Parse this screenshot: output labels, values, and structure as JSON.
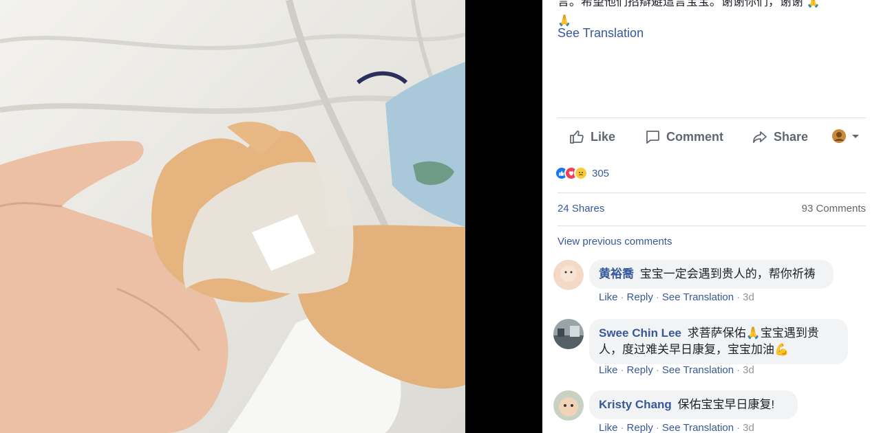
{
  "post": {
    "text_line": "言。希望他们招辯避這言宝宝。谢谢你们，谢谢",
    "pray_emoji": "🙏",
    "see_translation": "See Translation"
  },
  "actions": {
    "like": "Like",
    "comment": "Comment",
    "share": "Share"
  },
  "reactions": {
    "types": [
      "like",
      "love",
      "sad"
    ],
    "count": "305"
  },
  "stats": {
    "shares": "24 Shares",
    "comments": "93 Comments"
  },
  "view_previous": "View previous comments",
  "comments": [
    {
      "author": "黄裕喬",
      "text": "宝宝一定会遇到贵人的，帮你祈祷",
      "like": "Like",
      "reply": "Reply",
      "see_translation": "See Translation",
      "time": "3d"
    },
    {
      "author": "Swee Chin Lee",
      "text_line1": "求菩萨保佑",
      "text_line1b": "宝宝遇到贵",
      "text_line2": "人，度过难关早日康复，宝宝加油",
      "emoji_pray": "🙏",
      "emoji_muscle": "💪",
      "like": "Like",
      "reply": "Reply",
      "see_translation": "See Translation",
      "time": "3d"
    },
    {
      "author": "Kristy Chang",
      "text": "保佑宝宝早日康复!",
      "like": "Like",
      "reply": "Reply",
      "see_translation": "See Translation",
      "time": "3d"
    }
  ],
  "colors": {
    "link": "#365899",
    "text": "#1d2129",
    "muted": "#606770",
    "bubble": "#f2f3f5"
  }
}
